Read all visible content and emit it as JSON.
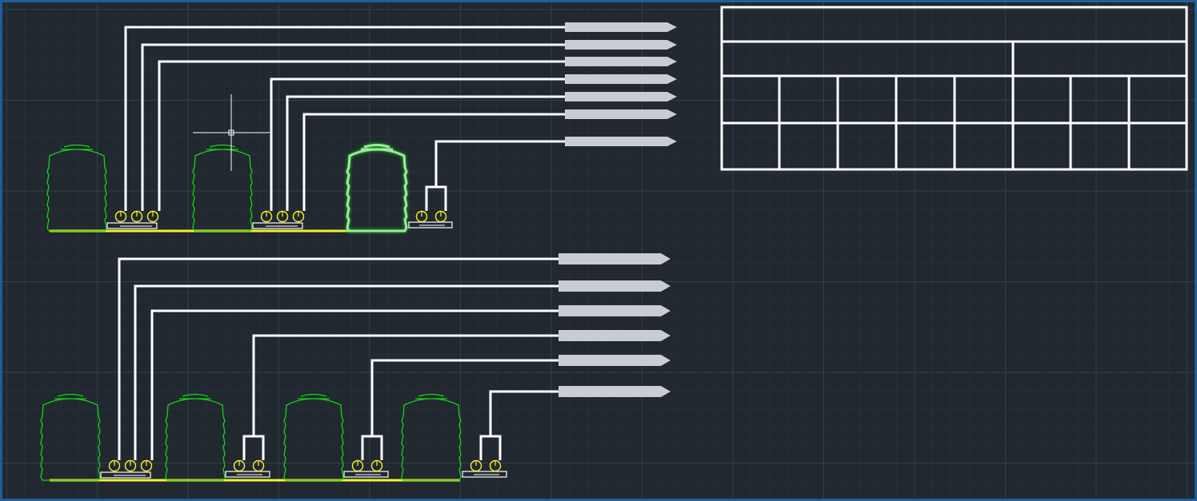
{
  "colors": {
    "background": "#212830",
    "grid_minor": "#2a323c",
    "grid_major": "#34404c",
    "frame": "#1f5f99",
    "line": "#ffffff",
    "tank": "#17d317",
    "tank_selected": "#9ee89e",
    "pump": "#ffef2a",
    "base_line": "#f4f22f",
    "tag_fill": "#c9ccd0"
  },
  "icons": {
    "crosshair": "crosshair-cursor-icon",
    "tank": "water-tank-icon",
    "pump": "pump-icon",
    "outlet_tag": "outlet-arrow-tag-icon"
  },
  "diagram": {
    "upper_row": {
      "tank_count": 3,
      "pump_groups": [
        3,
        3,
        2
      ],
      "outlets": 7,
      "selected_tank": 3
    },
    "lower_row": {
      "tank_count": 4,
      "pump_groups": [
        3,
        2,
        2,
        2
      ],
      "outlets": 6
    },
    "title_table": {
      "rows": 4,
      "columns": 8
    }
  }
}
